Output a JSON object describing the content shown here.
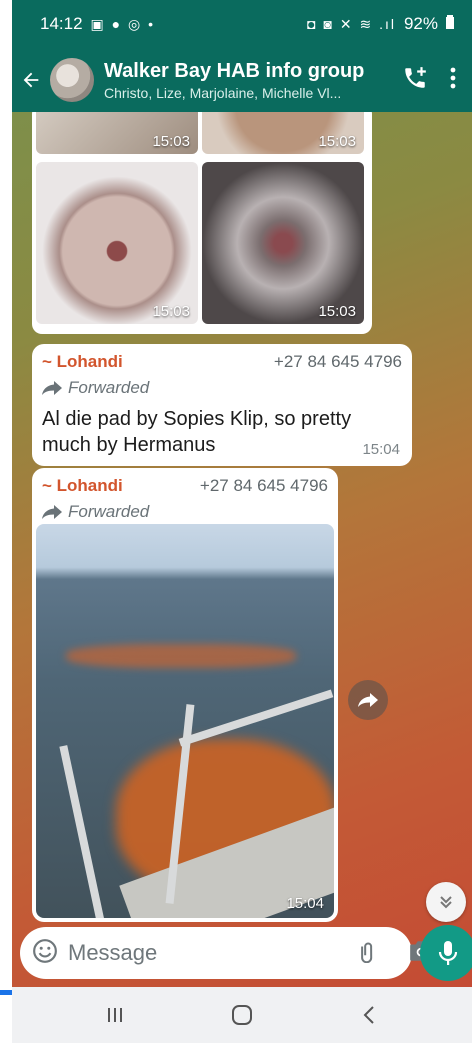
{
  "status_bar": {
    "time": "14:12",
    "left_icons": "▣ ● ◎ •",
    "right_icons": "◘ ◙ ✕ ≋ .ıl",
    "battery": "92%"
  },
  "header": {
    "title": "Walker Bay HAB info group",
    "members": "Christo, Lize, Marjolaine, Michelle Vl..."
  },
  "image_grid": {
    "timestamps": [
      "15:03",
      "15:03",
      "15:03",
      "15:03"
    ]
  },
  "messages": [
    {
      "sender": "~ Lohandi",
      "phone": "+27 84 645 4796",
      "forwarded_label": "Forwarded",
      "text": "Al die pad by Sopies Klip, so pretty much by Hermanus",
      "time": "15:04"
    },
    {
      "sender": "~ Lohandi",
      "phone": "+27 84 645 4796",
      "forwarded_label": "Forwarded",
      "photo_time": "15:04"
    }
  ],
  "composer": {
    "placeholder": "Message"
  },
  "icons": {
    "back": "arrow-left-icon",
    "add_call": "phone-plus-icon",
    "menu": "more-vert-icon",
    "forward": "share-arrow-icon",
    "scroll_down": "double-chevron-down-icon",
    "emoji": "emoji-icon",
    "attach": "paperclip-icon",
    "camera": "camera-icon",
    "mic": "microphone-icon",
    "nav_recent": "recents-icon",
    "nav_home": "home-icon",
    "nav_back": "back-chevron-icon"
  },
  "colors": {
    "header_bg": "#0a6b5e",
    "sender_name": "#d2552d",
    "mic_button": "#129a86"
  }
}
